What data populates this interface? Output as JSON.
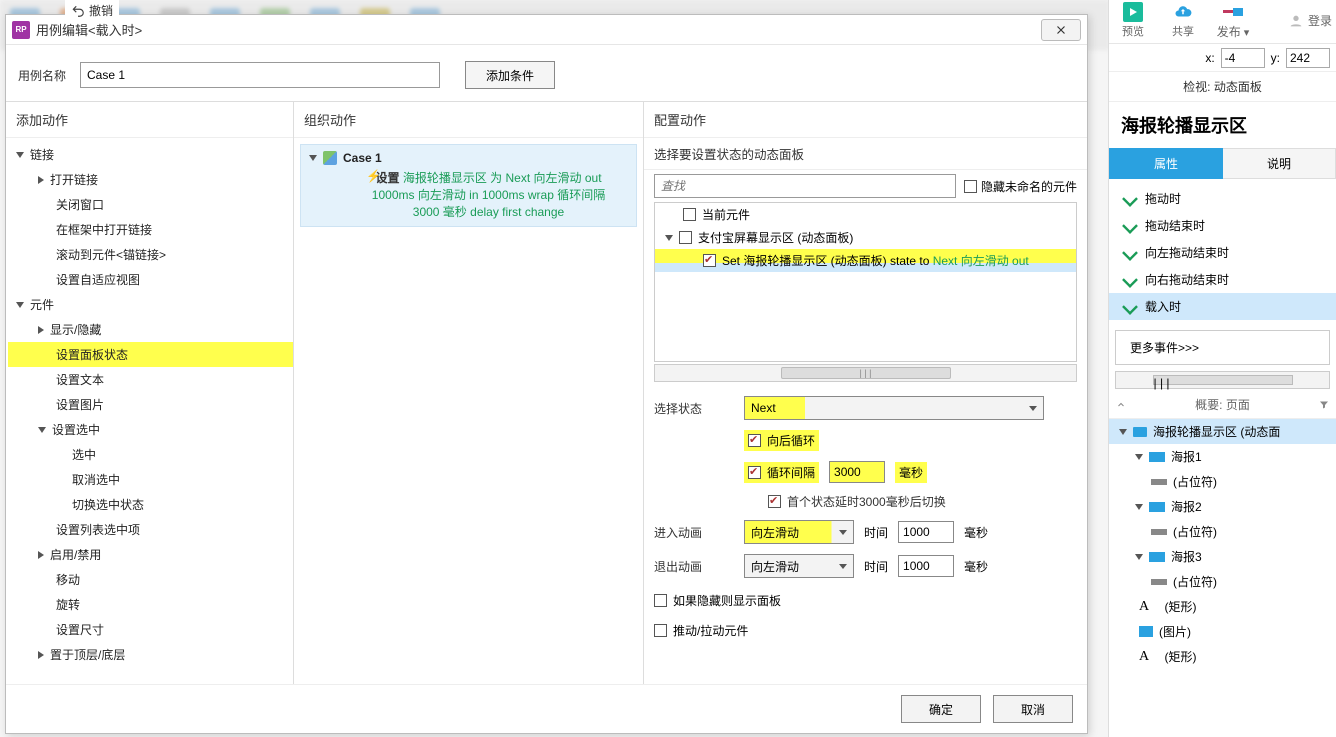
{
  "undo": "撤销",
  "dialog": {
    "title": "用例编辑<载入时>",
    "caseNameLabel": "用例名称",
    "caseName": "Case 1",
    "addCondition": "添加条件",
    "addActionHeader": "添加动作",
    "organizeHeader": "组织动作",
    "configureHeader": "配置动作",
    "ok": "确定",
    "cancel": "取消"
  },
  "actionTree": {
    "linkGroup": "链接",
    "openLink": "打开链接",
    "closeWindow": "关闭窗口",
    "openInIframe": "在框架中打开链接",
    "scrollToWidget": "滚动到元件<锚链接>",
    "setAdaptiveView": "设置自适应视图",
    "widgetGroup": "元件",
    "showHide": "显示/隐藏",
    "setPanelState": "设置面板状态",
    "setText": "设置文本",
    "setImage": "设置图片",
    "setSelected": "设置选中",
    "selected": "选中",
    "unselected": "取消选中",
    "toggleSelected": "切换选中状态",
    "setListSelected": "设置列表选中项",
    "enableDisable": "启用/禁用",
    "move": "移动",
    "rotate": "旋转",
    "setSize": "设置尺寸",
    "bringFrontBack": "置于顶层/底层"
  },
  "organize": {
    "caseLabel": "Case 1",
    "verb": "设置",
    "target": "海报轮播显示区",
    "params1": "为 Next 向左滑动 out",
    "params2": "1000ms 向左滑动 in 1000ms wrap 循环间隔",
    "params3": "3000 毫秒 delay first change"
  },
  "config": {
    "selectPanelLabel": "选择要设置状态的动态面板",
    "searchPlaceholder": "査找",
    "hideUnnamed": "隐藏未命名的元件",
    "currentWidget": "当前元件",
    "alipayPanel": "支付宝屏幕显示区 (动态面板)",
    "setStatePrefix": "Set 海报轮播显示区 (动态面板) state to ",
    "setStateSuffix": "Next 向左滑动 out",
    "selectStateLabel": "选择状态",
    "stateValue": "Next",
    "wrapLabel": "向后循环",
    "loopIntervalLabel": "循环间隔",
    "loopIntervalValue": "3000",
    "msLabel": "毫秒",
    "delayFirstLabel": "首个状态延时3000毫秒后切换",
    "animateInLabel": "进入动画",
    "animateOutLabel": "退出动画",
    "slideLeft": "向左滑动",
    "timeLabel": "时间",
    "timeValue": "1000",
    "showIfHidden": "如果隐藏则显示面板",
    "pushPull": "推动/拉动元件"
  },
  "rightRail": {
    "preview": "预览",
    "share": "共享",
    "publish": "发布",
    "login": "登录",
    "xLabel": "x:",
    "xVal": "-4",
    "yLabel": "y:",
    "yVal": "242",
    "inspect": "检视: 动态面板",
    "panelTitle": "海报轮播显示区",
    "tabProps": "属性",
    "tabNotes": "说明",
    "eventDrag": "拖动时",
    "eventDragEnd": "拖动结束时",
    "eventSwipeLeftEnd": "向左拖动结束时",
    "eventSwipeRightEnd": "向右拖动结束时",
    "eventLoad": "载入时",
    "moreEvents": "更多事件>>>",
    "outlineLabel": "概要: 页面",
    "outlineRoot": "海报轮播显示区 (动态面",
    "poster1": "海报1",
    "poster2": "海报2",
    "poster3": "海报3",
    "placeholder": "(占位符)",
    "rect": "(矩形)",
    "image": "(图片)"
  }
}
